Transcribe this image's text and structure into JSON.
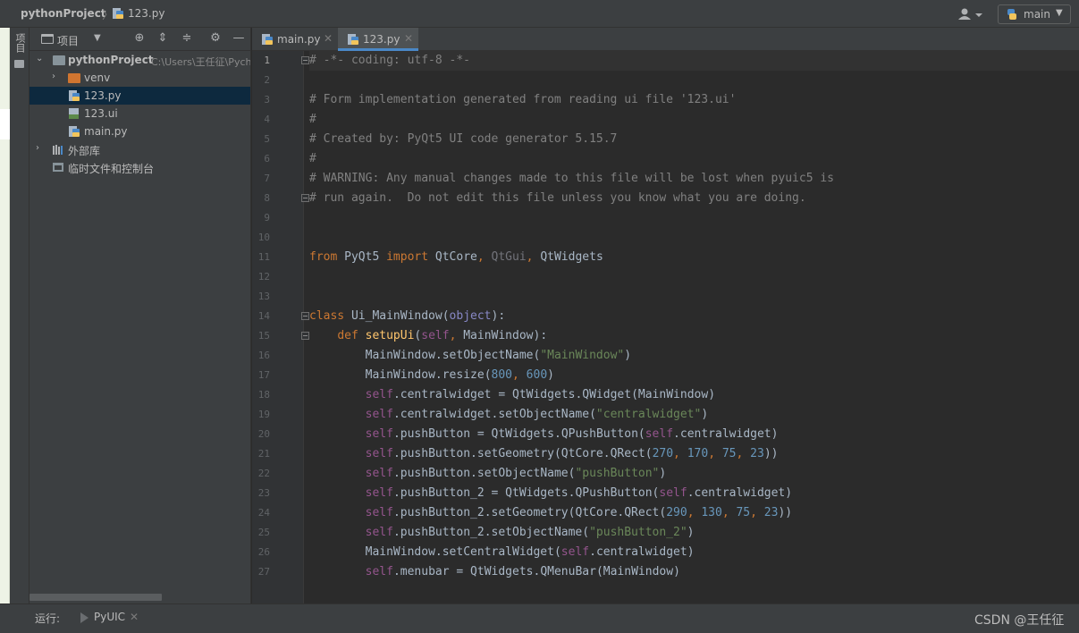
{
  "titlebar": {
    "project": "pythonProject",
    "separator": "〉",
    "file": "123.py",
    "branch": "main"
  },
  "tool_strip": {
    "project_tab": "项目"
  },
  "project_panel": {
    "title": "项目",
    "tree": [
      {
        "label": "pythonProject",
        "path": "C:\\Users\\王任征\\PycharmProjects\\pythonProject",
        "type": "project",
        "expanded": true
      },
      {
        "label": "venv",
        "type": "folder",
        "expanded": false
      },
      {
        "label": "123.py",
        "type": "python",
        "selected": true
      },
      {
        "label": "123.ui",
        "type": "ui"
      },
      {
        "label": "main.py",
        "type": "python"
      },
      {
        "label": "外部库",
        "type": "libraries",
        "expanded": false
      },
      {
        "label": "临时文件和控制台",
        "type": "scratches"
      }
    ]
  },
  "editor": {
    "tabs": [
      {
        "label": "main.py",
        "active": false
      },
      {
        "label": "123.py",
        "active": true
      }
    ],
    "lines": [
      "# -*- coding: utf-8 -*-",
      "",
      "# Form implementation generated from reading ui file '123.ui'",
      "#",
      "# Created by: PyQt5 UI code generator 5.15.7",
      "#",
      "# WARNING: Any manual changes made to this file will be lost when pyuic5 is",
      "# run again.  Do not edit this file unless you know what you are doing.",
      "",
      "",
      "from PyQt5 import QtCore, QtGui, QtWidgets",
      "",
      "",
      "class Ui_MainWindow(object):",
      "    def setupUi(self, MainWindow):",
      "        MainWindow.setObjectName(\"MainWindow\")",
      "        MainWindow.resize(800, 600)",
      "        self.centralwidget = QtWidgets.QWidget(MainWindow)",
      "        self.centralwidget.setObjectName(\"centralwidget\")",
      "        self.pushButton = QtWidgets.QPushButton(self.centralwidget)",
      "        self.pushButton.setGeometry(QtCore.QRect(270, 170, 75, 23))",
      "        self.pushButton.setObjectName(\"pushButton\")",
      "        self.pushButton_2 = QtWidgets.QPushButton(self.centralwidget)",
      "        self.pushButton_2.setGeometry(QtCore.QRect(290, 130, 75, 23))",
      "        self.pushButton_2.setObjectName(\"pushButton_2\")",
      "        MainWindow.setCentralWidget(self.centralwidget)",
      "        self.menubar = QtWidgets.QMenuBar(MainWindow)"
    ]
  },
  "run_bar": {
    "label": "运行:",
    "tab": "PyUIC",
    "watermark": "CSDN @王任征"
  },
  "colors": {
    "background": "#2b2b2b",
    "panel": "#3c3f41",
    "keyword": "#cc7832",
    "string": "#6a8759",
    "number": "#6897bb",
    "comment": "#808080",
    "self": "#94558d",
    "function": "#ffc66d",
    "selection": "#0d293e",
    "active_tab_underline": "#4a88c7"
  }
}
